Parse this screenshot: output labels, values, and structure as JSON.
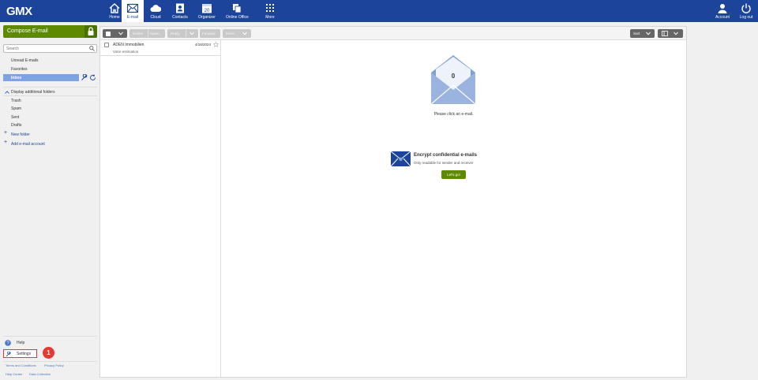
{
  "brand": {
    "logo": "GMX",
    "colors": {
      "topbar": "#1c449b",
      "compose": "#5d8a00",
      "inbox_highlight": "#7ea4e0",
      "annotation": "#e53935"
    }
  },
  "nav": {
    "items": [
      {
        "label": "Home",
        "icon": "home-icon"
      },
      {
        "label": "E-mail",
        "icon": "envelope-icon",
        "active": true
      },
      {
        "label": "Cloud",
        "icon": "cloud-icon"
      },
      {
        "label": "Contacts",
        "icon": "contacts-icon"
      },
      {
        "label": "Organizer",
        "icon": "calendar-icon",
        "day": "20"
      },
      {
        "label": "Online Office",
        "icon": "office-icon"
      },
      {
        "label": "More",
        "icon": "grid-icon"
      }
    ],
    "account": {
      "label": "Account",
      "icon": "user-icon"
    },
    "logout": {
      "label": "Log out",
      "icon": "power-icon"
    }
  },
  "sidebar": {
    "compose_label": "Compose E-mail",
    "search_placeholder": "Search",
    "folders_top": [
      "Unread E-mails",
      "Favorites"
    ],
    "inbox_label": "Inbox",
    "more_folders_label": "Display additional folders",
    "folders_more": [
      "Trash",
      "Spam",
      "Sent",
      "Drafts"
    ],
    "new_folder": "New folder",
    "add_account": "Add e-mail account",
    "help": "Help",
    "settings": "Settings",
    "annotation_number": "1",
    "footer_links": [
      "Terms and Conditions",
      "Privacy Policy",
      "Help Center",
      "Data Collection"
    ]
  },
  "toolbar": {
    "delete": "Delete",
    "spam": "Spam",
    "reply": "Reply",
    "forward": "Forward",
    "move": "Move",
    "sort": "Sort"
  },
  "mail_list": [
    {
      "sender": "ADEN Immobilien",
      "date": "4/18/2024",
      "subject": "Votre estimation"
    }
  ],
  "preview": {
    "envelope_count": "0",
    "please_text": "Please click an e-mail.",
    "encrypt_title": "Encrypt confidential e-mails",
    "encrypt_sub": "Only readable for sender and receiver",
    "encrypt_button": "Let's go!"
  }
}
